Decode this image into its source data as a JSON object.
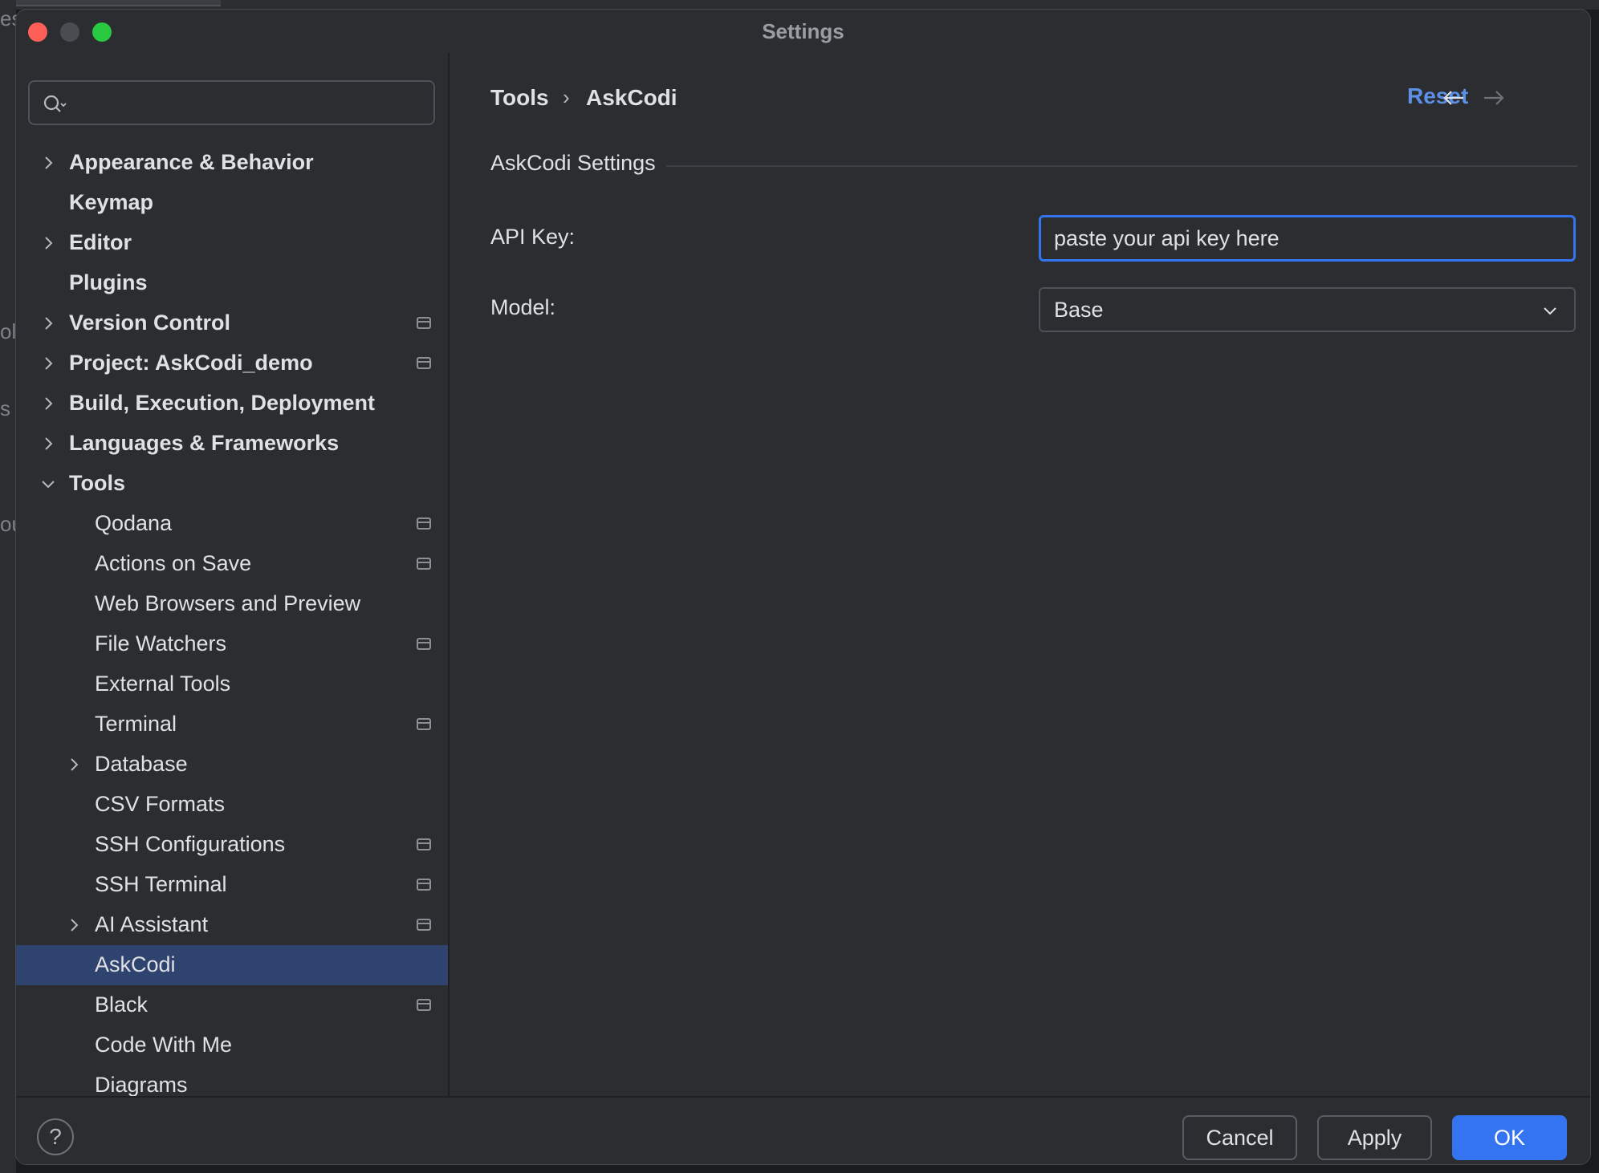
{
  "background": {
    "fragments": [
      "es",
      "ol",
      "s",
      "ou"
    ]
  },
  "window": {
    "title": "Settings"
  },
  "sidebar": {
    "search": {
      "value": "",
      "placeholder": ""
    },
    "items": [
      {
        "label": "Appearance & Behavior",
        "bold": true,
        "level": 0,
        "expandable": true,
        "expanded": false,
        "badge": false
      },
      {
        "label": "Keymap",
        "bold": true,
        "level": 0,
        "expandable": false,
        "badge": false
      },
      {
        "label": "Editor",
        "bold": true,
        "level": 0,
        "expandable": true,
        "expanded": false,
        "badge": false
      },
      {
        "label": "Plugins",
        "bold": true,
        "level": 0,
        "expandable": false,
        "badge": false
      },
      {
        "label": "Version Control",
        "bold": true,
        "level": 0,
        "expandable": true,
        "expanded": false,
        "badge": true
      },
      {
        "label": "Project: AskCodi_demo",
        "bold": true,
        "level": 0,
        "expandable": true,
        "expanded": false,
        "badge": true
      },
      {
        "label": "Build, Execution, Deployment",
        "bold": true,
        "level": 0,
        "expandable": true,
        "expanded": false,
        "badge": false
      },
      {
        "label": "Languages & Frameworks",
        "bold": true,
        "level": 0,
        "expandable": true,
        "expanded": false,
        "badge": false
      },
      {
        "label": "Tools",
        "bold": true,
        "level": 0,
        "expandable": true,
        "expanded": true,
        "badge": false
      },
      {
        "label": "Qodana",
        "bold": false,
        "level": 1,
        "expandable": false,
        "badge": true
      },
      {
        "label": "Actions on Save",
        "bold": false,
        "level": 1,
        "expandable": false,
        "badge": true
      },
      {
        "label": "Web Browsers and Preview",
        "bold": false,
        "level": 1,
        "expandable": false,
        "badge": false
      },
      {
        "label": "File Watchers",
        "bold": false,
        "level": 1,
        "expandable": false,
        "badge": true
      },
      {
        "label": "External Tools",
        "bold": false,
        "level": 1,
        "expandable": false,
        "badge": false
      },
      {
        "label": "Terminal",
        "bold": false,
        "level": 1,
        "expandable": false,
        "badge": true
      },
      {
        "label": "Database",
        "bold": false,
        "level": 1,
        "expandable": true,
        "expanded": false,
        "badge": false
      },
      {
        "label": "CSV Formats",
        "bold": false,
        "level": 1,
        "expandable": false,
        "badge": false
      },
      {
        "label": "SSH Configurations",
        "bold": false,
        "level": 1,
        "expandable": false,
        "badge": true
      },
      {
        "label": "SSH Terminal",
        "bold": false,
        "level": 1,
        "expandable": false,
        "badge": true
      },
      {
        "label": "AI Assistant",
        "bold": false,
        "level": 1,
        "expandable": true,
        "expanded": false,
        "badge": true
      },
      {
        "label": "AskCodi",
        "bold": false,
        "level": 1,
        "expandable": false,
        "badge": false,
        "selected": true
      },
      {
        "label": "Black",
        "bold": false,
        "level": 1,
        "expandable": false,
        "badge": true
      },
      {
        "label": "Code With Me",
        "bold": false,
        "level": 1,
        "expandable": false,
        "badge": false
      },
      {
        "label": "Diagrams",
        "bold": false,
        "level": 1,
        "expandable": false,
        "badge": false
      }
    ]
  },
  "content": {
    "breadcrumb": {
      "parent": "Tools",
      "separator": "›",
      "current": "AskCodi"
    },
    "reset_label": "Reset",
    "section_title": "AskCodi Settings",
    "api_key": {
      "label": "API Key:",
      "value": "paste your api key here"
    },
    "model": {
      "label": "Model:",
      "selected": "Base"
    }
  },
  "footer": {
    "help_label": "?",
    "cancel_label": "Cancel",
    "apply_label": "Apply",
    "ok_label": "OK"
  },
  "colors": {
    "accent": "#3574f0",
    "link": "#5c8fe6",
    "selection": "#2e436e",
    "window_bg": "#2b2d30"
  },
  "icons": {
    "search": "search-icon",
    "back": "arrow-left-icon",
    "forward": "arrow-right-icon",
    "dropdown": "chevron-down-icon",
    "badge": "project-level-icon"
  }
}
